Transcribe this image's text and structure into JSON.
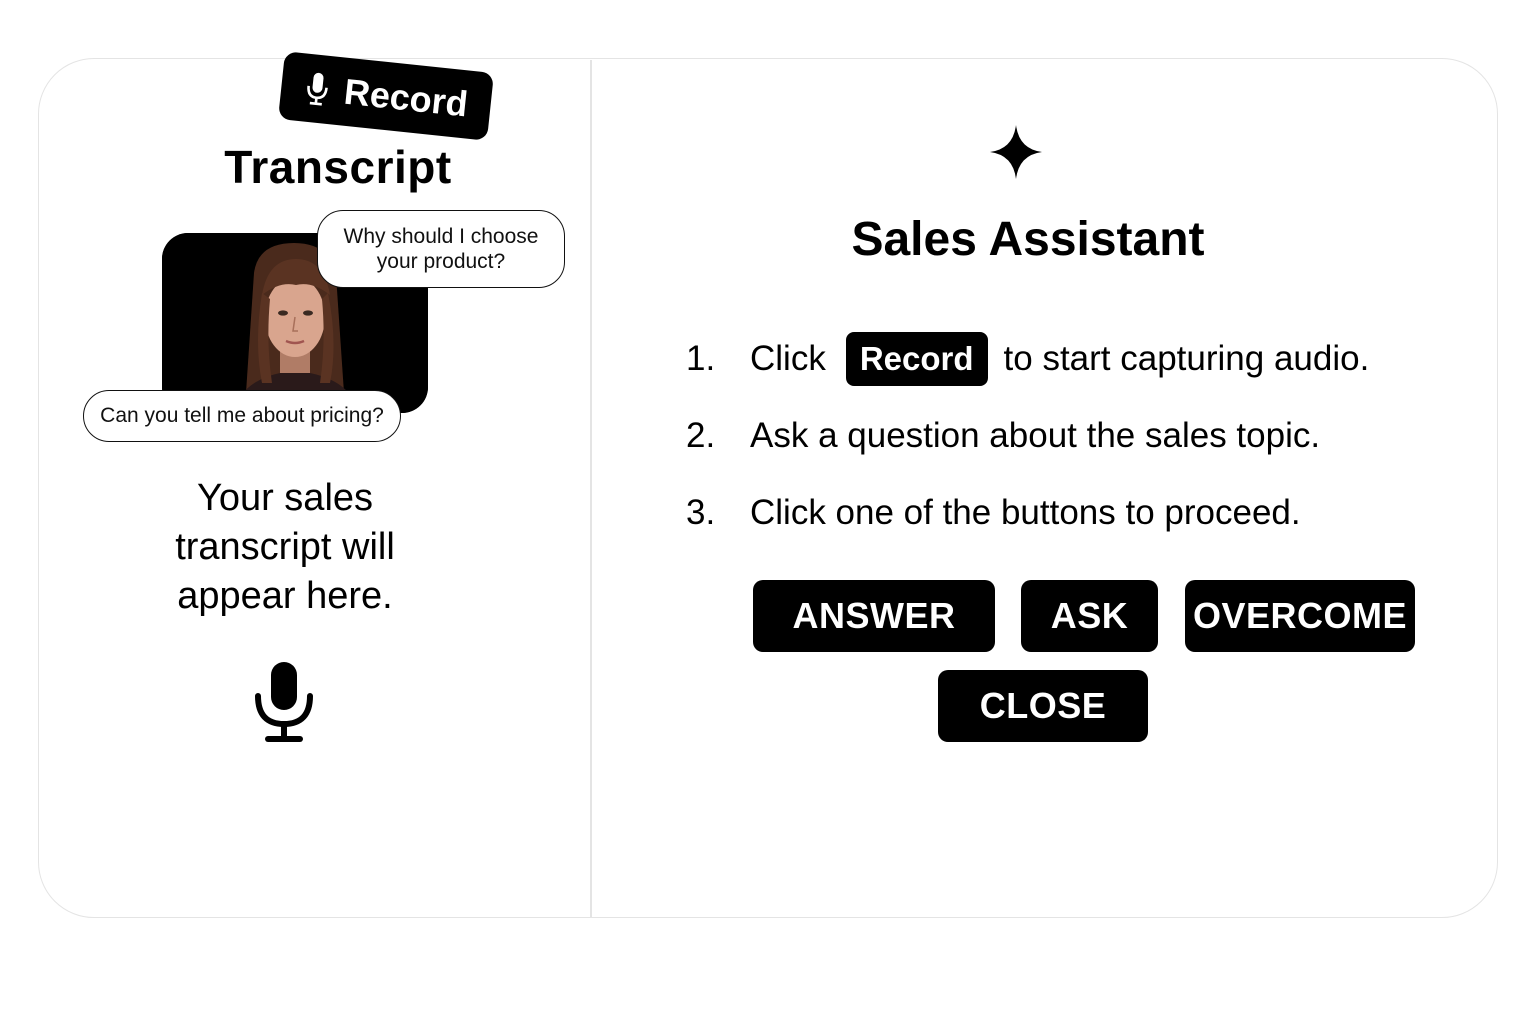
{
  "left_panel": {
    "record_button_label": "Record",
    "title": "Transcript",
    "bubble_top": "Why should I choose your product?",
    "bubble_bottom": "Can you tell me about pricing?",
    "placeholder_lines": [
      "Your sales",
      "transcript will",
      "appear here."
    ],
    "icons": {
      "record": "microphone-icon",
      "bottom": "microphone-icon"
    }
  },
  "right_panel": {
    "icon": "sparkle-icon",
    "title": "Sales Assistant",
    "steps": [
      {
        "number": "1.",
        "before": "Click",
        "button": "Record",
        "after": "to start capturing audio."
      },
      {
        "number": "2.",
        "text": "Ask a question about the sales topic."
      },
      {
        "number": "3.",
        "text": "Click one of the buttons to proceed."
      }
    ],
    "buttons": {
      "answer": "ANSWER",
      "ask": "ASK",
      "overcome": "OVERCOME",
      "close": "CLOSE"
    }
  },
  "colors": {
    "primary": "#000000",
    "background": "#ffffff",
    "border": "#e4e4e4"
  }
}
